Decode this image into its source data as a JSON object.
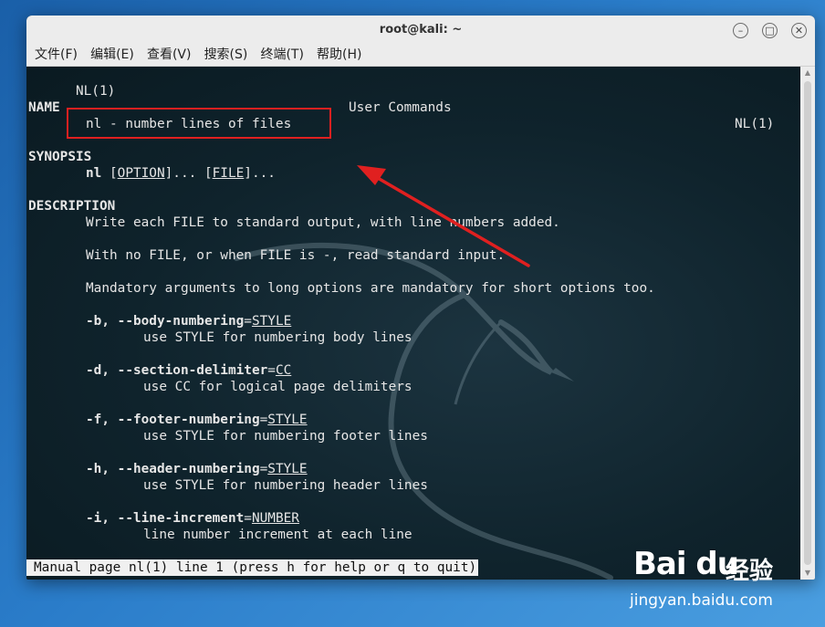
{
  "window": {
    "title": "root@kali: ~",
    "minimize_glyph": "–",
    "maximize_glyph": "□",
    "close_glyph": "✕"
  },
  "menubar": {
    "items": [
      "文件(F)",
      "编辑(E)",
      "查看(V)",
      "搜索(S)",
      "终端(T)",
      "帮助(H)"
    ]
  },
  "man": {
    "header_left": "NL(1)",
    "header_center": "User Commands",
    "header_right": "NL(1)",
    "name_heading": "NAME",
    "name_line": "nl - number lines of files",
    "synopsis_heading": "SYNOPSIS",
    "synopsis_cmd": "nl",
    "synopsis_option": "OPTION",
    "synopsis_sep": "]... [",
    "synopsis_file": "FILE",
    "synopsis_end": "]...",
    "description_heading": "DESCRIPTION",
    "desc1": "Write each FILE to standard output, with line numbers added.",
    "desc2": "With no FILE, or when FILE is -, read standard input.",
    "desc3": "Mandatory arguments to long options are mandatory for short options too.",
    "options": [
      {
        "flag": "-b, --body-numbering",
        "arg": "STYLE",
        "desc": "use STYLE for numbering body lines"
      },
      {
        "flag": "-d, --section-delimiter",
        "arg": "CC",
        "desc": "use CC for logical page delimiters"
      },
      {
        "flag": "-f, --footer-numbering",
        "arg": "STYLE",
        "desc": "use STYLE for numbering footer lines"
      },
      {
        "flag": "-h, --header-numbering",
        "arg": "STYLE",
        "desc": "use STYLE for numbering header lines"
      },
      {
        "flag": "-i, --line-increment",
        "arg": "NUMBER",
        "desc": "line number increment at each line"
      }
    ],
    "status": "Manual page nl(1) line 1 (press h for help or q to quit)"
  },
  "annotation": {
    "color": "#e02020"
  },
  "watermark": {
    "brand": "Bai du",
    "sub": "经验",
    "url": "jingyan.baidu.com"
  }
}
